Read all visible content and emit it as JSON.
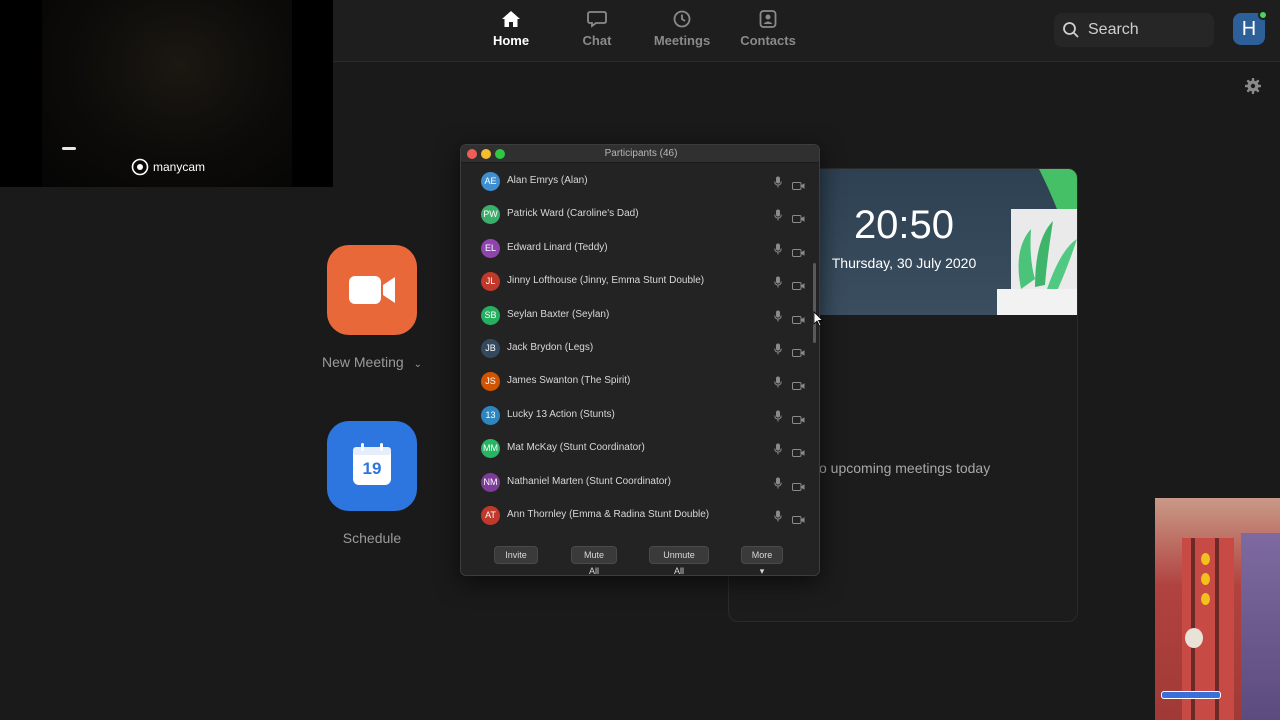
{
  "nav": {
    "tabs": [
      {
        "label": "Home",
        "icon": "home-icon",
        "active": true
      },
      {
        "label": "Chat",
        "icon": "chat-icon",
        "active": false
      },
      {
        "label": "Meetings",
        "icon": "clock-icon",
        "active": false
      },
      {
        "label": "Contacts",
        "icon": "contacts-icon",
        "active": false
      }
    ],
    "search_placeholder": "Search",
    "avatar_initial": "H",
    "avatar_color": "#2d5f99",
    "status_color": "#4bd35c"
  },
  "overlay": {
    "brand": "manycam"
  },
  "actions": {
    "new_meeting_label": "New Meeting",
    "new_meeting_color": "#e8683a",
    "schedule_label": "Schedule",
    "schedule_day": "19",
    "schedule_color": "#2d76e0"
  },
  "clock": {
    "time": "20:50",
    "date": "Thursday, 30 July 2020",
    "no_meetings": "o upcoming meetings today"
  },
  "participants": {
    "title": "Participants (46)",
    "list": [
      {
        "initials": "AE",
        "name": "Alan Emrys (Alan)",
        "color": "#3e8ed0"
      },
      {
        "initials": "PW",
        "name": "Patrick Ward (Caroline's Dad)",
        "color": "#3aae6a"
      },
      {
        "initials": "EL",
        "name": "Edward Linard (Teddy)",
        "color": "#8e44ad"
      },
      {
        "initials": "JL",
        "name": "Jinny Lofthouse (Jinny, Emma Stunt Double)",
        "color": "#c0392b"
      },
      {
        "initials": "SB",
        "name": "Seylan Baxter (Seylan)",
        "color": "#27ae60"
      },
      {
        "initials": "JB",
        "name": "Jack Brydon (Legs)",
        "color": "#34495e"
      },
      {
        "initials": "JS",
        "name": "James Swanton (The Spirit)",
        "color": "#d35400"
      },
      {
        "initials": "13",
        "name": "Lucky 13 Action (Stunts)",
        "color": "#2e86c1"
      },
      {
        "initials": "MM",
        "name": "Mat McKay (Stunt Coordinator)",
        "color": "#28b463"
      },
      {
        "initials": "NM",
        "name": "Nathaniel Marten (Stunt Coordinator)",
        "color": "#7d3c98"
      },
      {
        "initials": "AT",
        "name": "Ann Thornley (Emma & Radina Stunt Double)",
        "color": "#c0392b"
      }
    ],
    "buttons": {
      "invite": "Invite",
      "mute_all": "Mute All",
      "unmute_all": "Unmute All",
      "more": "More"
    }
  }
}
